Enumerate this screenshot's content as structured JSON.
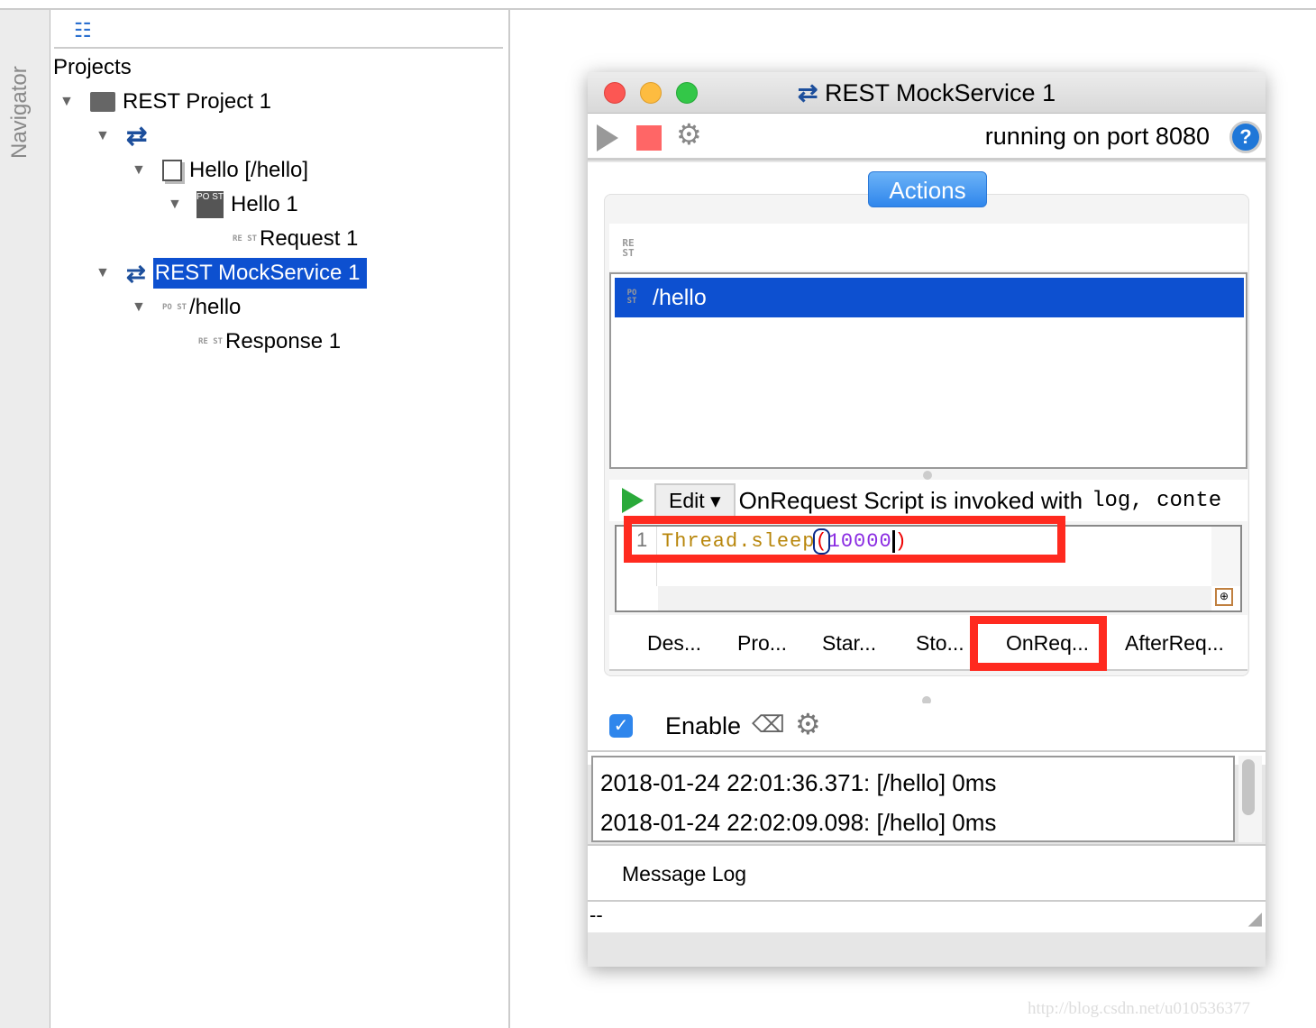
{
  "navigator": {
    "label": "Navigator"
  },
  "tree": {
    "root": "Projects",
    "items": [
      {
        "label": "REST Project 1",
        "icon": "folder-icon"
      },
      {
        "label": "",
        "icon": "rest-service-icon"
      },
      {
        "label": "Hello [/hello]",
        "icon": "resource-icon"
      },
      {
        "label": "Hello 1",
        "icon": "method-icon"
      },
      {
        "label": "Request 1",
        "icon": "rest-request-icon"
      },
      {
        "label": "REST MockService 1",
        "icon": "mockservice-icon",
        "selected": true
      },
      {
        "label": "/hello",
        "icon": "mock-action-icon"
      },
      {
        "label": "Response 1",
        "icon": "mock-response-icon"
      }
    ]
  },
  "dialog": {
    "title": "REST MockService 1",
    "status": "running on port 8080",
    "actions_label": "Actions",
    "rest_label": "RE\nST",
    "actions": [
      {
        "label": "/hello",
        "selected": true
      }
    ],
    "edit_label": "Edit",
    "script_desc": "OnRequest Script is invoked with",
    "script_desc_code": "log, conte",
    "line_number": "1",
    "code": {
      "ident": "Thread.sleep",
      "open": "(",
      "num": "10000",
      "close": ")"
    },
    "tabs": [
      "Des...",
      "Pro...",
      "Star...",
      "Sto...",
      "OnReq...",
      "AfterReq..."
    ],
    "active_tab": "OnReq...",
    "enable_label": "Enable",
    "enable_checked": true,
    "log": [
      "2018-01-24 22:01:36.371: [/hello] 0ms",
      "2018-01-24 22:02:09.098: [/hello] 0ms"
    ],
    "message_log_label": "Message Log",
    "status_bar": "--"
  },
  "colors": {
    "selection": "#0d50d0",
    "highlight": "#ff2a1f",
    "accent": "#2f86ec"
  },
  "watermark": "http://blog.csdn.net/u010536377"
}
